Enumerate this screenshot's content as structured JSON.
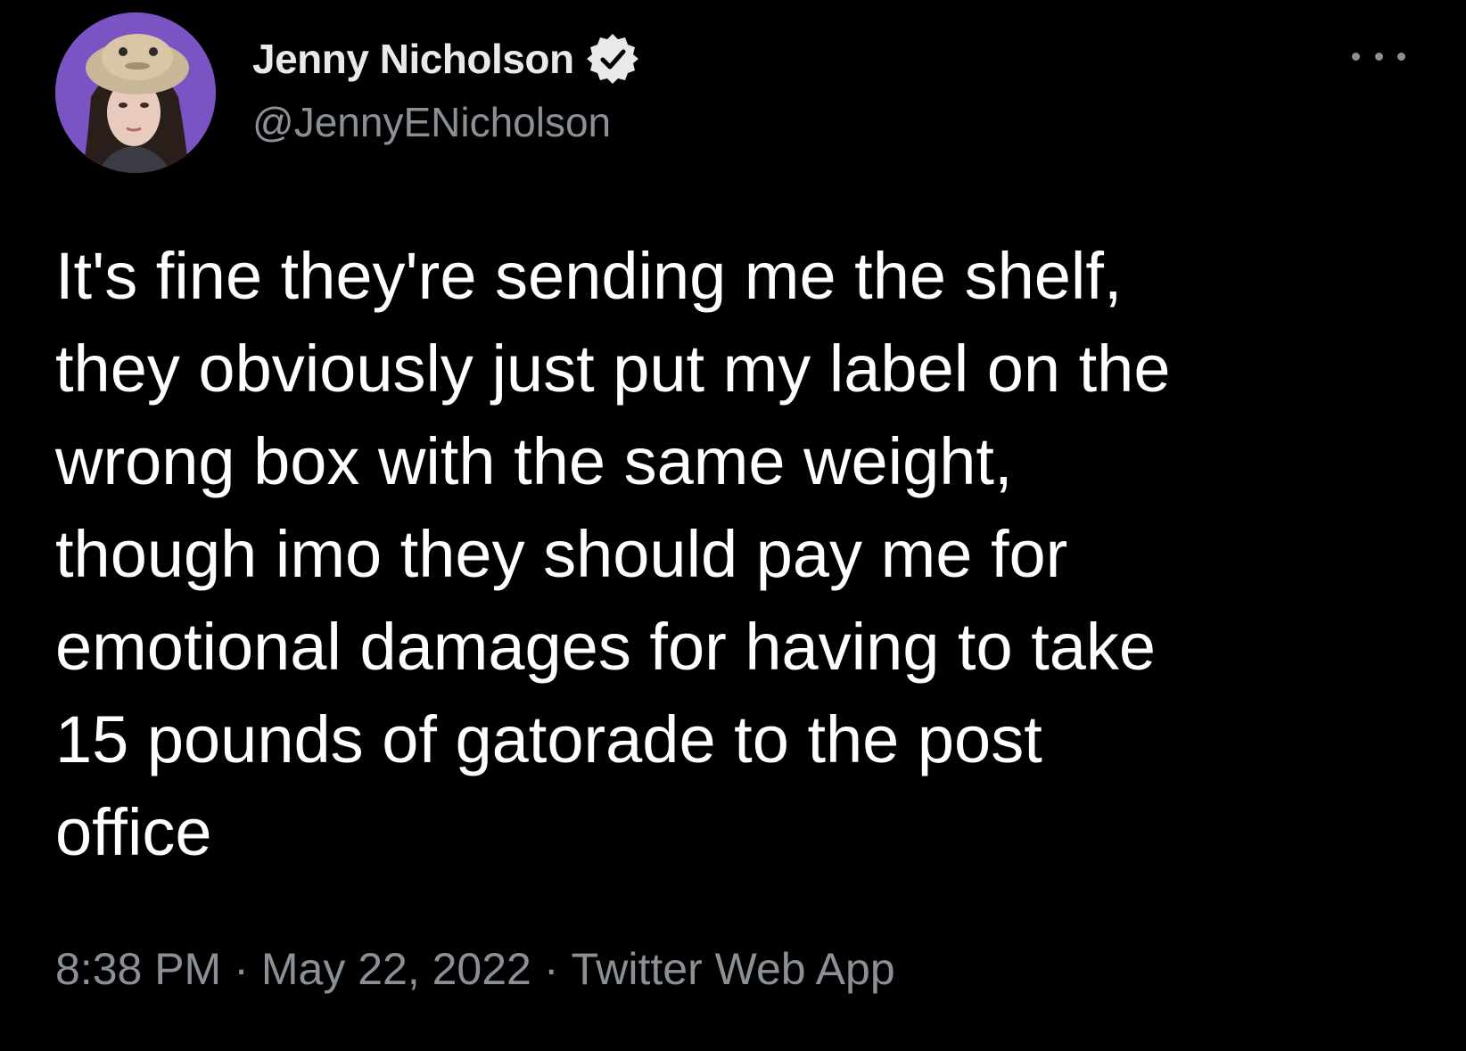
{
  "author": {
    "display_name": "Jenny Nicholson",
    "handle": "@JennyENicholson",
    "verified_icon": "verified-badge-icon",
    "avatar_icon": "avatar"
  },
  "menu": {
    "more_icon": "more-options-icon"
  },
  "tweet": {
    "text": "It's fine they're sending me the shelf,\nthey obviously just put my label on the\nwrong box with the same weight,\nthough imo they should pay me for\nemotional damages for having to take\n15 pounds of gatorade to the post\noffice"
  },
  "meta": {
    "time": "8:38 PM",
    "separator": "·",
    "date": "May 22, 2022",
    "source": "Twitter Web App"
  },
  "colors": {
    "background": "#000000",
    "text_primary": "#ffffff",
    "text_secondary": "#8b9096",
    "avatar_bg": "#7b54c4"
  }
}
